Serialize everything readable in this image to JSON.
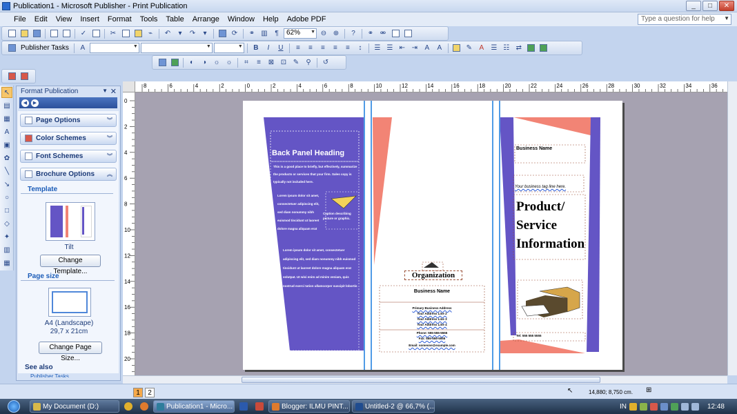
{
  "window": {
    "title": "Publication1 - Microsoft Publisher - Print Publication"
  },
  "menu": {
    "items": [
      "File",
      "Edit",
      "View",
      "Insert",
      "Format",
      "Tools",
      "Table",
      "Arrange",
      "Window",
      "Help",
      "Adobe PDF"
    ],
    "help_placeholder": "Type a question for help"
  },
  "toolbar": {
    "zoom": "62%",
    "publisher_tasks": "Publisher Tasks"
  },
  "taskpane": {
    "title": "Format Publication",
    "sections": [
      "Page Options",
      "Color Schemes",
      "Font Schemes",
      "Brochure Options"
    ],
    "template_label": "Template",
    "template_name": "Tilt",
    "change_template": "Change Template...",
    "page_size_label": "Page size",
    "page_size_name": "A4 (Landscape)",
    "page_size_dims": "29,7 x 21cm",
    "change_page_size": "Change Page Size...",
    "see_also": "See also",
    "see_also_link": "Publisher Tasks"
  },
  "ruler": {
    "h_labels": [
      "8",
      "6",
      "4",
      "2",
      "0",
      "2",
      "4",
      "6",
      "8",
      "10",
      "12",
      "14",
      "16",
      "18",
      "20",
      "22",
      "24",
      "26",
      "28",
      "30",
      "32",
      "34",
      "36"
    ],
    "v_labels": [
      "0",
      "2",
      "4",
      "6",
      "8",
      "10",
      "12",
      "14",
      "16",
      "18",
      "20"
    ]
  },
  "brochure": {
    "back_heading": "Back Panel Heading",
    "back_body_1": "This is a good place to briefly, but effectively, summarize the products or services that your firm. Sales copy is typically not included here.",
    "back_body_2": "Lorem ipsum dolor sit amet, consectetuer adipiscing elit, sed diam nonummy nibh euismod tincidunt ut laoreet dolore magna aliquam erat volutpat. Ut wisi enim ad minim veniam, quis nostrud exerci tation ullamcorper suscipit lobortis nisl ut aliquip ex ea commodo consequat.",
    "caption": "Caption describing picture or graphic.",
    "organization": "Organization",
    "business_name_middle": "Business Name",
    "address_lines": [
      "Primary Business Address",
      "Your Address Line 2",
      "Your Address Line 3",
      "Your Address Line 4",
      "Phone: 555-555-5555",
      "Fax: 555-555-5555",
      "Email: someone@example.com"
    ],
    "business_name_right": "Business Name",
    "tagline": "Your business tag line here.",
    "product_title": "Product/ Service Information",
    "phone_right": "Tel: 555 555 5555"
  },
  "status": {
    "pages": [
      "1",
      "2"
    ],
    "coords": "14,880; 8,750 cm."
  },
  "taskbar": {
    "apps": [
      {
        "label": "My Document (D:)",
        "active": false,
        "color": "#d9b94a"
      },
      {
        "label": "Publication1 - Micro...",
        "active": true,
        "color": "#2e7d9c"
      },
      {
        "label": "Blogger: ILMU PINT...",
        "active": false,
        "color": "#e07b2e"
      },
      {
        "label": "Untitled-2 @ 66,7% (...",
        "active": false,
        "color": "#1f4c8f"
      }
    ],
    "lang": "IN",
    "time": "12:48"
  },
  "colors": {
    "purple": "#6455c5",
    "salmon": "#f28475",
    "guide": "#4f9be6"
  }
}
